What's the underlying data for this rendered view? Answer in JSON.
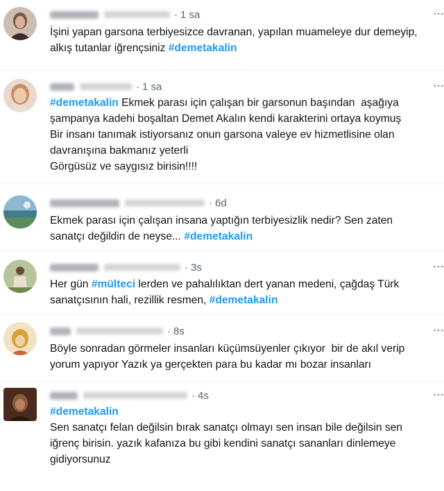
{
  "colors": {
    "text": "#0f1419",
    "muted": "#536471",
    "hashtag": "#1d9bf0",
    "divider": "#eff3f4"
  },
  "tweets": [
    {
      "time": "1 sa",
      "separator": "·",
      "more_icon": "more-dots-icon",
      "body": [
        {
          "t": "İşini yapan garsona terbiyesizce davranan, yapılan muameleye dur demeyip,\nalkış tutanlar iğrençsiniz ",
          "tag": false
        },
        {
          "t": "#demetakalin",
          "tag": true
        }
      ]
    },
    {
      "time": "1 sa",
      "separator": "·",
      "more_icon": "more-dots-icon",
      "body": [
        {
          "t": "#demetakalin",
          "tag": true
        },
        {
          "t": " Ekmek parası için çalışan bir garsonun başından  aşağıya\nşampanya kadehi boşaltan Demet Akalın kendi karakterini ortaya koymuş\nBir insanı tanımak istiyorsanız onun garsona valeye ev hizmetlisine olan\ndavranışına bakmanız yeterli\nGörgüsüz ve saygısız birisin!!!!",
          "tag": false
        }
      ]
    },
    {
      "time": "6d",
      "separator": "·",
      "more_icon": "more-dots-icon",
      "body": [
        {
          "t": "Ekmek parası için çalışan insana yaptığın terbiyesizlik nedir? Sen zaten\nsanatçı değildin de neyse... ",
          "tag": false
        },
        {
          "t": "#demetakalin",
          "tag": true
        }
      ]
    },
    {
      "time": "3s",
      "separator": "·",
      "more_icon": "more-dots-icon",
      "body": [
        {
          "t": "Her gün ",
          "tag": false
        },
        {
          "t": "#mülteci",
          "tag": true
        },
        {
          "t": " lerden ve pahalılıktan dert yanan medeni, çağdaş Türk\nsanatçısının hali, rezillik resmen, ",
          "tag": false
        },
        {
          "t": "#demetakalin",
          "tag": true
        }
      ]
    },
    {
      "time": "8s",
      "separator": "·",
      "more_icon": "more-dots-icon",
      "body": [
        {
          "t": "Böyle sonradan görmeler insanları küçümsüyenler çıkıyor  bir de akıl verip\nyorum yapıyor Yazık ya gerçekten para bu kadar mı bozar insanları",
          "tag": false
        }
      ]
    },
    {
      "time": "4s",
      "separator": "·",
      "more_icon": "more-dots-icon",
      "body": [
        {
          "t": "#demetakalin",
          "tag": true
        },
        {
          "t": "\nSen sanatçı felan değilsin bırak sanatçı olmayı sen insan bile değilsin sen\niğrenç birisin. yazık kafanıza bu gibi kendini sanatçı sananları dinlemeye\ngidiyorsunuz",
          "tag": false
        }
      ]
    }
  ]
}
